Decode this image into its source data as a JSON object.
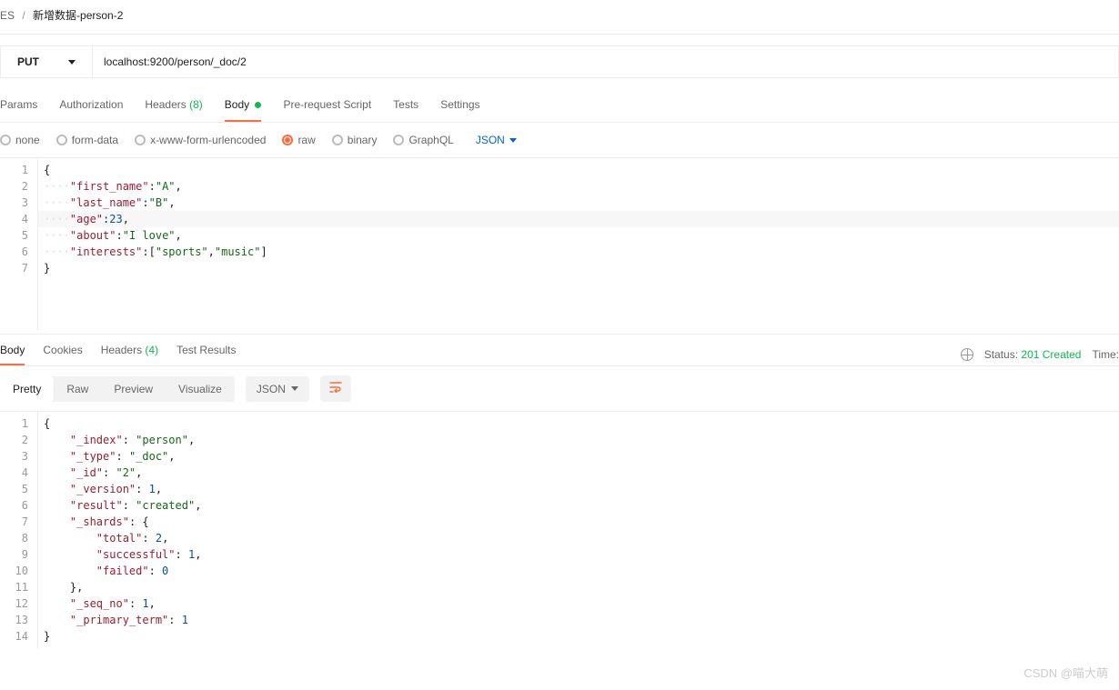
{
  "breadcrumb": {
    "root": "ES",
    "current": "新增数据-person-2"
  },
  "request": {
    "method": "PUT",
    "url": "localhost:9200/person/_doc/2"
  },
  "tabs": {
    "params": "Params",
    "authorization": "Authorization",
    "headers_label": "Headers",
    "headers_count": "(8)",
    "body": "Body",
    "prerequest": "Pre-request Script",
    "tests": "Tests",
    "settings": "Settings"
  },
  "body_types": {
    "none": "none",
    "formdata": "form-data",
    "urlencoded": "x-www-form-urlencoded",
    "raw": "raw",
    "binary": "binary",
    "graphql": "GraphQL",
    "format": "JSON"
  },
  "request_body": {
    "lines": [
      "1",
      "2",
      "3",
      "4",
      "5",
      "6",
      "7"
    ],
    "l1": "{",
    "l2_k": "\"first_name\"",
    "l2_v": "\"A\"",
    "l3_k": "\"last_name\"",
    "l3_v": "\"B\"",
    "l4_k": "\"age\"",
    "l4_v": "23",
    "l5_k": "\"about\"",
    "l5_v": "\"I love\"",
    "l6_k": "\"interests\"",
    "l6_a": "\"sports\"",
    "l6_b": "\"music\"",
    "l7": "}"
  },
  "response_tabs": {
    "body": "Body",
    "cookies": "Cookies",
    "headers_label": "Headers",
    "headers_count": "(4)",
    "testresults": "Test Results"
  },
  "response_meta": {
    "status_label": "Status:",
    "status_value": "201 Created",
    "time_label": "Time:"
  },
  "view_tabs": {
    "pretty": "Pretty",
    "raw": "Raw",
    "preview": "Preview",
    "visualize": "Visualize",
    "format": "JSON"
  },
  "response_body": {
    "lines": [
      "1",
      "2",
      "3",
      "4",
      "5",
      "6",
      "7",
      "8",
      "9",
      "10",
      "11",
      "12",
      "13",
      "14"
    ],
    "r1": "{",
    "r2_k": "\"_index\"",
    "r2_v": "\"person\"",
    "r3_k": "\"_type\"",
    "r3_v": "\"_doc\"",
    "r4_k": "\"_id\"",
    "r4_v": "\"2\"",
    "r5_k": "\"_version\"",
    "r5_v": "1",
    "r6_k": "\"result\"",
    "r6_v": "\"created\"",
    "r7_k": "\"_shards\"",
    "r7_v": "{",
    "r8_k": "\"total\"",
    "r8_v": "2",
    "r9_k": "\"successful\"",
    "r9_v": "1",
    "r10_k": "\"failed\"",
    "r10_v": "0",
    "r11": "}",
    "r12_k": "\"_seq_no\"",
    "r12_v": "1",
    "r13_k": "\"_primary_term\"",
    "r13_v": "1",
    "r14": "}"
  },
  "watermark": "CSDN @喵大萌"
}
